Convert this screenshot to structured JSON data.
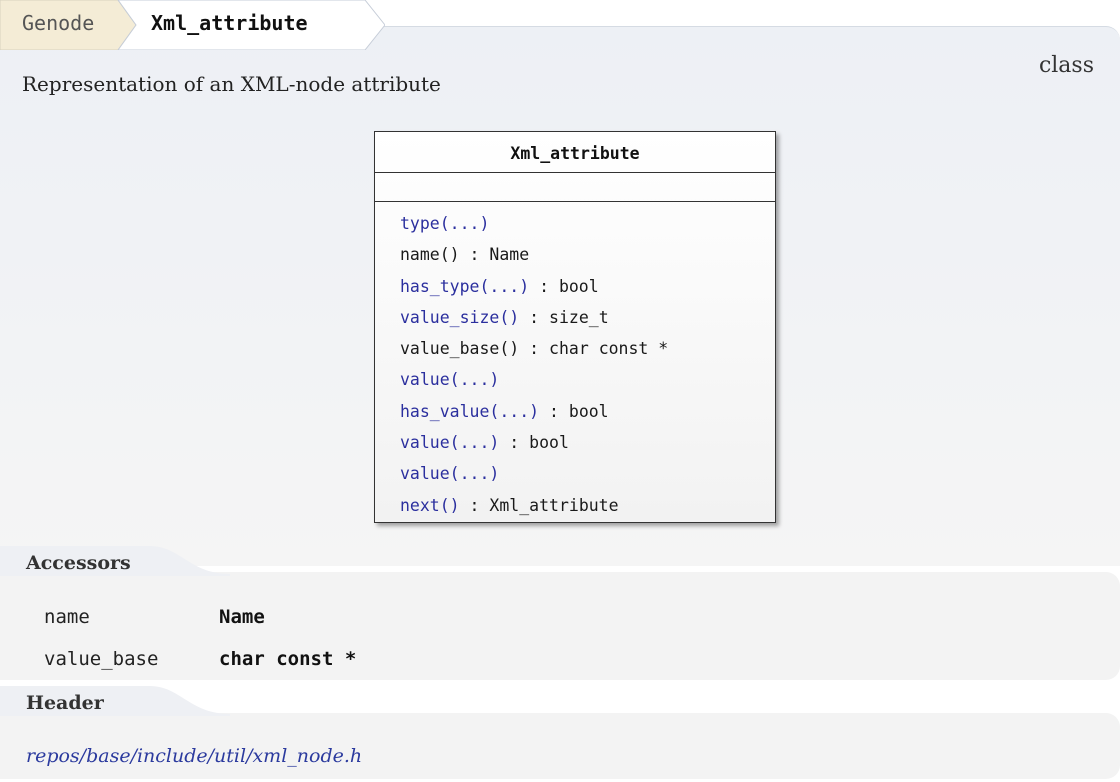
{
  "breadcrumb": {
    "parent": "Genode",
    "current": "Xml_attribute"
  },
  "description": "Representation of an XML-node attribute",
  "kind": "class",
  "uml": {
    "title": "Xml_attribute",
    "methods": [
      {
        "name": "type(...)",
        "ret": "",
        "linked": true
      },
      {
        "name": "name()",
        "ret": " : Name",
        "linked": false
      },
      {
        "name": "has_type(...)",
        "ret": " : bool",
        "linked": true
      },
      {
        "name": "value_size()",
        "ret": " : size_t",
        "linked": true
      },
      {
        "name": "value_base()",
        "ret": " : char const *",
        "linked": false
      },
      {
        "name": "value(...)",
        "ret": "",
        "linked": true
      },
      {
        "name": "has_value(...)",
        "ret": " : bool",
        "linked": true
      },
      {
        "name": "value(...)",
        "ret": " : bool",
        "linked": true
      },
      {
        "name": "value(...)",
        "ret": "",
        "linked": true
      },
      {
        "name": "next()",
        "ret": " : Xml_attribute",
        "linked": true
      }
    ]
  },
  "accessors": {
    "label": "Accessors",
    "rows": [
      {
        "name": "name",
        "type": "Name"
      },
      {
        "name": "value_base",
        "type": "char const *"
      }
    ]
  },
  "header": {
    "label": "Header",
    "path": "repos/base/include/util/xml_node.h"
  },
  "colors": {
    "link": "#2b2f9e",
    "panel": "#edf0f5"
  }
}
